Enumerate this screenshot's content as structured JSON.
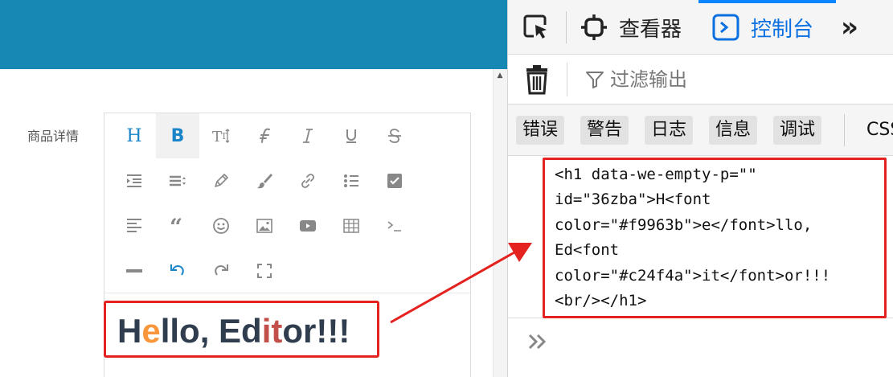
{
  "page": {
    "field_label": "商品详情"
  },
  "editor": {
    "toolbar": [
      {
        "icon": "heading-icon",
        "text": "H"
      },
      {
        "icon": "bold-icon",
        "text": "B"
      },
      {
        "icon": "font-size-icon"
      },
      {
        "icon": "font-name-icon"
      },
      {
        "icon": "italic-icon"
      },
      {
        "icon": "underline-icon"
      },
      {
        "icon": "strikethrough-icon"
      },
      {
        "icon": "indent-icon"
      },
      {
        "icon": "line-height-icon"
      },
      {
        "icon": "fore-color-icon"
      },
      {
        "icon": "back-color-icon"
      },
      {
        "icon": "link-icon"
      },
      {
        "icon": "list-icon"
      },
      {
        "icon": "todo-icon"
      },
      {
        "icon": "justify-icon"
      },
      {
        "icon": "quote-icon"
      },
      {
        "icon": "emoticon-icon"
      },
      {
        "icon": "image-icon"
      },
      {
        "icon": "video-icon"
      },
      {
        "icon": "table-icon"
      },
      {
        "icon": "code-icon"
      },
      {
        "icon": "splitline-icon"
      },
      {
        "icon": "undo-icon"
      },
      {
        "icon": "redo-icon"
      },
      {
        "icon": "fullscreen-icon"
      }
    ],
    "content": {
      "segments": [
        {
          "text": "H",
          "color": "#2f3d4e"
        },
        {
          "text": "e",
          "color": "#f9963b"
        },
        {
          "text": "llo, Ed",
          "color": "#2f3d4e"
        },
        {
          "text": "it",
          "color": "#c24f4a"
        },
        {
          "text": "or!!!",
          "color": "#2f3d4e"
        }
      ]
    }
  },
  "devtools": {
    "tabs": {
      "inspector": "查看器",
      "console": "控制台",
      "more": "»"
    },
    "filter": {
      "placeholder": "过滤输出"
    },
    "levels": [
      "错误",
      "警告",
      "日志",
      "信息",
      "调试"
    ],
    "css_label": "CSS",
    "output": {
      "code_lines": [
        "<h1 data-we-empty-p=\"\"",
        "id=\"36zba\">H<font",
        "color=\"#f9963b\">e</font>llo,",
        "Ed<font",
        "color=\"#c24f4a\">it</font>or!!!",
        "<br/></h1>"
      ]
    }
  },
  "colors": {
    "header_bg": "#1787b4",
    "accent": "#0a84ff",
    "highlight": "#e4221f"
  }
}
